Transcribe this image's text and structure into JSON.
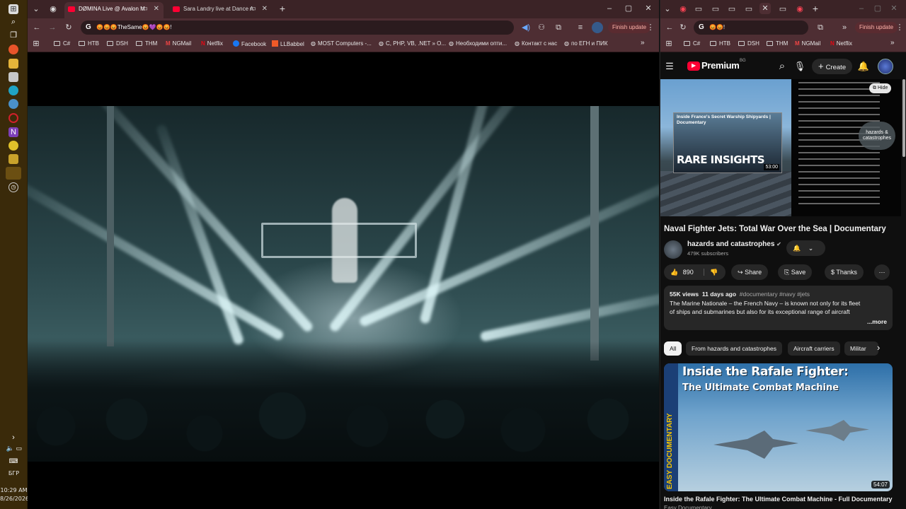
{
  "taskbar": {
    "lang": "БГР",
    "time": "10:29 AM",
    "date": "8/26/2026",
    "icons": [
      "windows-icon",
      "search-icon",
      "task-view-icon",
      "firefox-icon",
      "files-icon",
      "app-icon",
      "edge-icon",
      "settings-icon",
      "opera-icon",
      "onenote-icon",
      "chrome-icon",
      "terminal-icon",
      "chrome-active-icon",
      "clock-icon"
    ]
  },
  "left_browser": {
    "tabs": [
      {
        "title": "DØMINA Live @ Avalon M",
        "active": true
      },
      {
        "title": "Sara Landry live at Dance A",
        "active": false
      }
    ],
    "address": "😡😡😡TheSame😡💜😡😡!",
    "finish_update": "Finish update",
    "bookmarks": [
      "C#",
      "HTB",
      "DSH",
      "THM",
      "NGMail",
      "Netflix",
      "Facebook",
      "LLBabbel",
      "MOST Computers -...",
      "C, PHP, VB, .NET » O...",
      "Необходими опти...",
      "Контакт с нас",
      "по ЕГН и ПИК"
    ]
  },
  "right_browser": {
    "address": "😡😡!",
    "finish_update": "Finish update",
    "bookmarks": [
      "C#",
      "HTB",
      "DSH",
      "THM",
      "NGMail",
      "Netflix"
    ],
    "youtube": {
      "logo": "Premium",
      "logo_sup": "BG",
      "create_label": "Create",
      "hide_label": "Hide",
      "player": {
        "card_title": "Inside France's Secret Warship Shipyards | Documentary",
        "card_big": "RARE INSIGHTS",
        "card_duration": "53:00",
        "channel_watermark": "hazards & catastrophes"
      },
      "video_title": "Naval Fighter Jets: Total War Over the Sea | Documentary",
      "channel": "hazards and catastrophes",
      "subscribers": "479K subscribers",
      "likes": "890",
      "share": "Share",
      "save": "Save",
      "thanks": "Thanks",
      "views": "55K views",
      "age": "11 days ago",
      "tags": "#documentary #navy #jets",
      "description": "The Marine Nationale – the French Navy – is known not only for its fleet of ships and submarines but also for its exceptional range of aircraft with diverse and specialised roles. In this intriguing documentary, we take a closer lo",
      "more": "...more",
      "chips": [
        "All",
        "From hazards and catastrophes",
        "Aircraft carriers",
        "Militar"
      ],
      "next": {
        "thumb_title_1": "Inside the Rafale Fighter:",
        "thumb_title_2": "The Ultimate Combat Machine",
        "side_text": "EASY DOCUMENTARY",
        "duration": "54:07",
        "title": "Inside the Rafale Fighter: The Ultimate Combat Machine - Full Documentary",
        "channel": "Easy Documentary"
      }
    }
  },
  "colors": {
    "tabstrip": "#3b2326",
    "toolbar": "#4e2e33",
    "youtube_red": "#ff0033",
    "taskbar": "#3a2a0a"
  }
}
